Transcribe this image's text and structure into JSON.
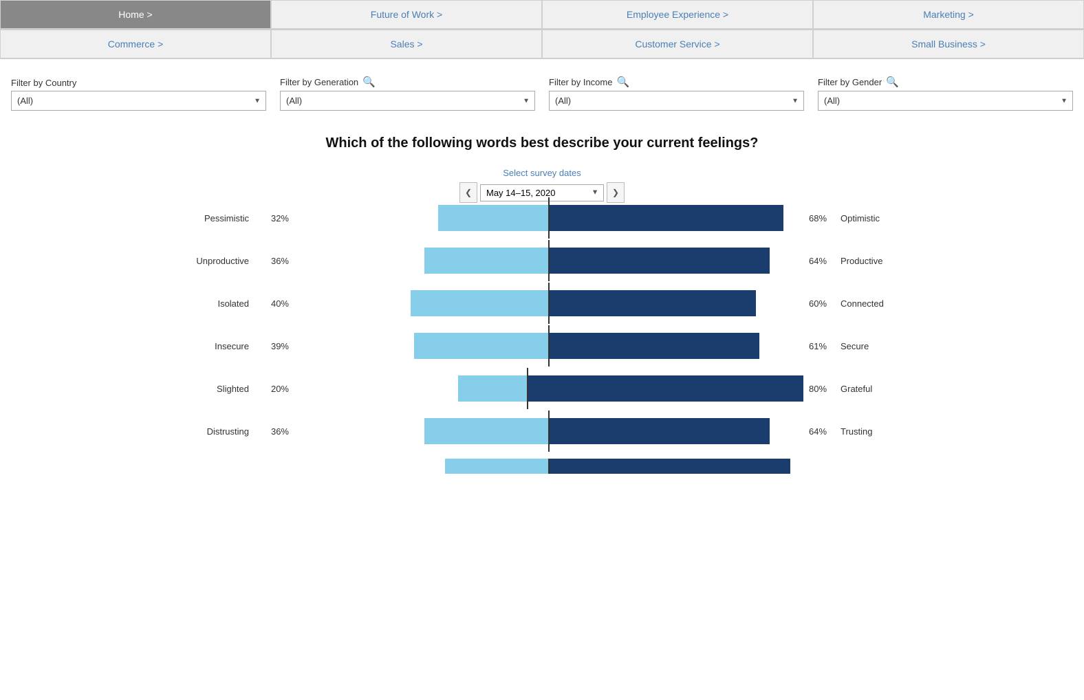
{
  "nav": {
    "row1": [
      {
        "label": "Home >",
        "active": true
      },
      {
        "label": "Future of Work >",
        "active": false
      },
      {
        "label": "Employee Experience >",
        "active": false
      },
      {
        "label": "Marketing >",
        "active": false
      }
    ],
    "row2": [
      {
        "label": "Commerce >",
        "active": false
      },
      {
        "label": "Sales >",
        "active": false
      },
      {
        "label": "Customer Service >",
        "active": false
      },
      {
        "label": "Small Business >",
        "active": false
      }
    ]
  },
  "filters": {
    "country": {
      "label": "Filter by Country",
      "value": "(All)",
      "options": [
        "(All)"
      ]
    },
    "generation": {
      "label": "Filter by Generation",
      "value": "(All)",
      "options": [
        "(All)"
      ],
      "has_search": true
    },
    "income": {
      "label": "Filter by Income",
      "value": "(All)",
      "options": [
        "(All)"
      ],
      "has_search": true
    },
    "gender": {
      "label": "Filter by Gender",
      "value": "(All)",
      "options": [
        "(All)"
      ],
      "has_search": true
    }
  },
  "chart": {
    "title": "Which of the following words best describe your current feelings?",
    "date_label": "Select survey dates",
    "date_value": "May 14–15, 2020",
    "date_options": [
      "May 14–15, 2020"
    ],
    "rows": [
      {
        "left_label": "Pessimistic",
        "left_pct": "32%",
        "left_val": 32,
        "right_val": 68,
        "right_pct": "68%",
        "right_label": "Optimistic"
      },
      {
        "left_label": "Unproductive",
        "left_pct": "36%",
        "left_val": 36,
        "right_val": 64,
        "right_pct": "64%",
        "right_label": "Productive"
      },
      {
        "left_label": "Isolated",
        "left_pct": "40%",
        "left_val": 40,
        "right_val": 60,
        "right_pct": "60%",
        "right_label": "Connected"
      },
      {
        "left_label": "Insecure",
        "left_pct": "39%",
        "left_val": 39,
        "right_val": 61,
        "right_pct": "61%",
        "right_label": "Secure"
      },
      {
        "left_label": "Slighted",
        "left_pct": "20%",
        "left_val": 20,
        "right_val": 80,
        "right_pct": "80%",
        "right_label": "Grateful"
      },
      {
        "left_label": "Distrusting",
        "left_pct": "36%",
        "left_val": 36,
        "right_val": 64,
        "right_pct": "64%",
        "right_label": "Trusting"
      },
      {
        "left_label": "",
        "left_pct": "",
        "left_val": 30,
        "right_val": 70,
        "right_pct": "",
        "right_label": "",
        "partial": true
      }
    ]
  }
}
